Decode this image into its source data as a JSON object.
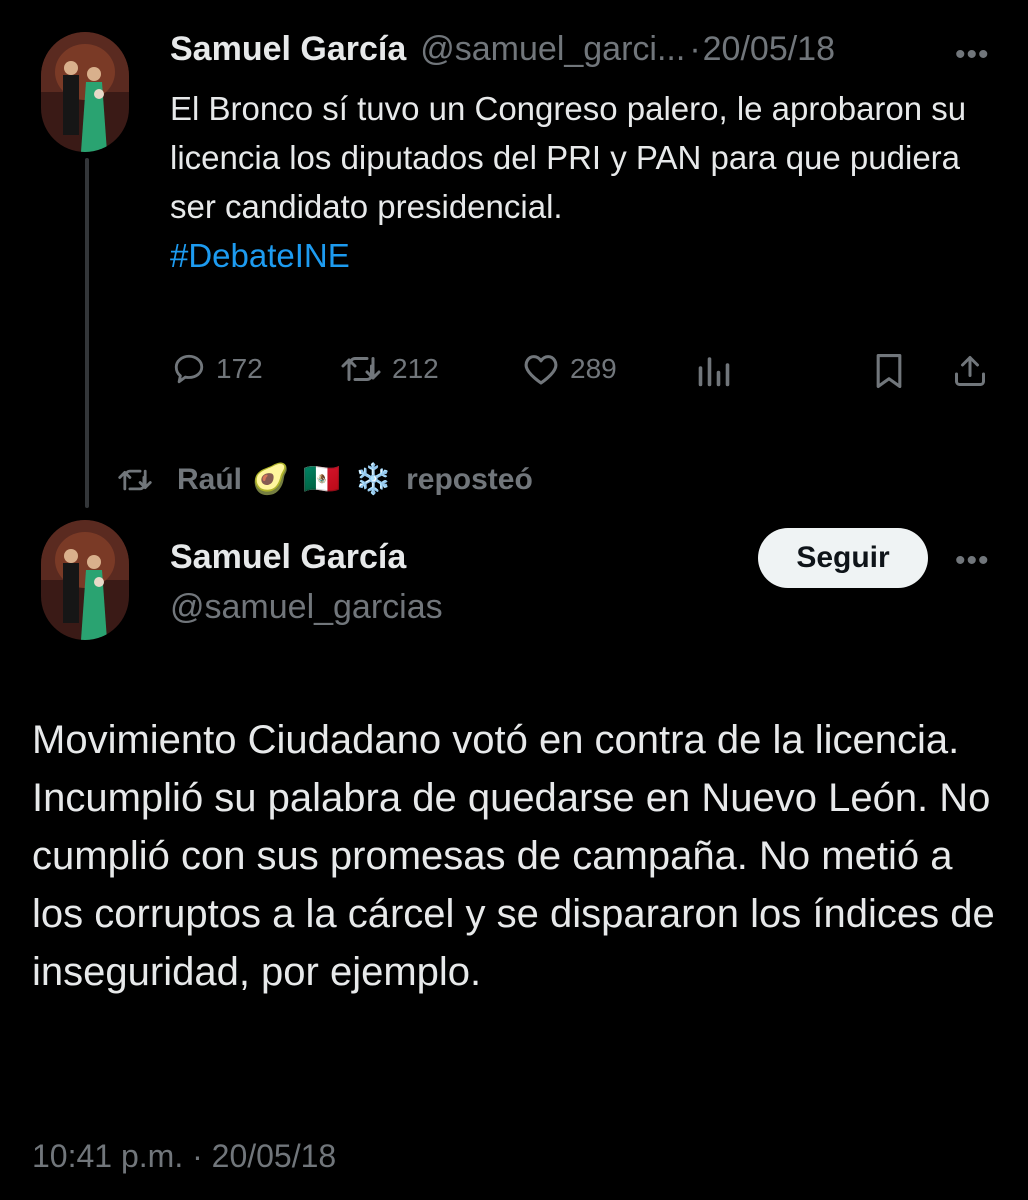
{
  "quoted_post": {
    "author_name": "Samuel García",
    "author_handle": "@samuel_garci...",
    "separator": "·",
    "date": "20/05/18",
    "more": "•••",
    "text": "El Bronco sí tuvo un Congreso palero, le aprobaron su licencia los diputados del PRI y PAN para que pudiera ser candidato presidencial.",
    "hashtag": "#DebateINE",
    "actions": {
      "replies": "172",
      "reposts": "212",
      "likes": "289"
    },
    "icons": [
      "reply-icon",
      "repost-icon",
      "like-icon",
      "views-icon",
      "bookmark-icon",
      "share-icon"
    ]
  },
  "repost_notice": {
    "user": "Raúl",
    "emojis": [
      "🥑",
      "🇲🇽",
      "❄️"
    ],
    "action": "reposteó"
  },
  "main_post": {
    "author_name": "Samuel García",
    "author_handle": "@samuel_garcias",
    "follow_label": "Seguir",
    "more": "•••",
    "text": "Movimiento Ciudadano votó en contra de la licencia. Incumplió su palabra de quedarse en Nuevo León. No cumplió con sus promesas de campaña. No metió a los corruptos a la cárcel y se dispararon los índices de inseguridad, por ejemplo.",
    "time": "10:41 p.m.",
    "separator": "·",
    "date": "20/05/18"
  },
  "colors": {
    "background": "#000000",
    "text": "#e7e9ea",
    "secondary": "#71767b",
    "link": "#1d9bf0",
    "button_bg": "#eff3f4"
  }
}
